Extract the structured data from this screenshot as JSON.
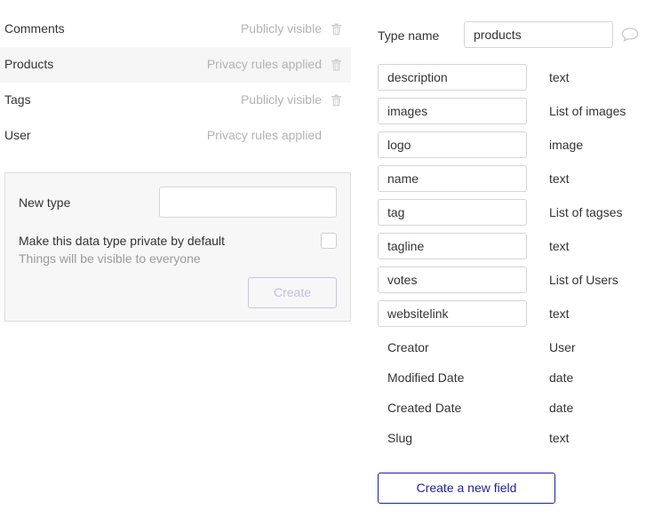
{
  "types": [
    {
      "name": "Comments",
      "privacy": "Publicly visible"
    },
    {
      "name": "Products",
      "privacy": "Privacy rules applied"
    },
    {
      "name": "Tags",
      "privacy": "Publicly visible"
    },
    {
      "name": "User",
      "privacy": "Privacy rules applied"
    }
  ],
  "new_type": {
    "label": "New type",
    "input_value": "",
    "private_label": "Make this data type private by default",
    "private_sub": "Things will be visible to everyone",
    "create_label": "Create",
    "private_checked": false
  },
  "type_editor": {
    "label": "Type name",
    "value": "products"
  },
  "fields": [
    {
      "name": "description",
      "type": "text"
    },
    {
      "name": "images",
      "type": "List of images"
    },
    {
      "name": "logo",
      "type": "image"
    },
    {
      "name": "name",
      "type": "text"
    },
    {
      "name": "tag",
      "type": "List of tagses"
    },
    {
      "name": "tagline",
      "type": "text"
    },
    {
      "name": "votes",
      "type": "List of Users"
    },
    {
      "name": "websitelink",
      "type": "text"
    }
  ],
  "builtin_fields": [
    {
      "name": "Creator",
      "type": "User"
    },
    {
      "name": "Modified Date",
      "type": "date"
    },
    {
      "name": "Created Date",
      "type": "date"
    },
    {
      "name": "Slug",
      "type": "text"
    }
  ],
  "create_field_label": "Create a new field",
  "icons": {
    "trash": "trash-icon",
    "comment": "comment-icon"
  },
  "colors": {
    "accent": "#1e1f9a",
    "muted": "#b3b3b3",
    "disabled": "#c0bde6"
  }
}
